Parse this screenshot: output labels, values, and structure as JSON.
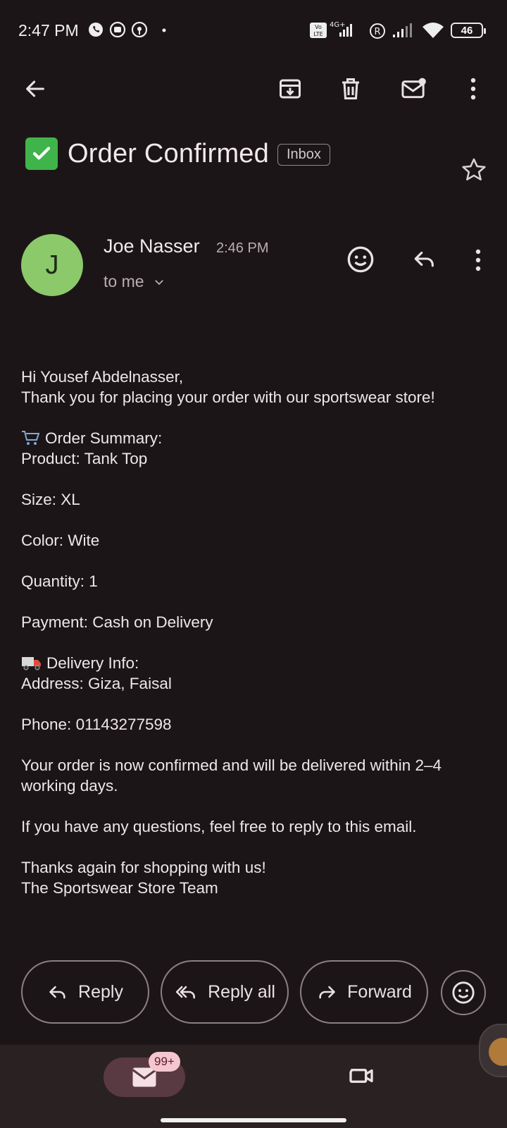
{
  "status_bar": {
    "time": "2:47 PM",
    "battery": "46"
  },
  "subject": {
    "title": "Order Confirmed",
    "label": "Inbox"
  },
  "sender": {
    "initial": "J",
    "name": "Joe Nasser",
    "time": "2:46 PM",
    "recipient": "to me"
  },
  "body": {
    "greeting": "Hi Yousef Abdelnasser,",
    "thanks": "Thank you for placing your order with our sportswear store!",
    "summary_heading": "Order Summary:",
    "product": "Product: Tank Top",
    "size": "Size: XL",
    "color": "Color: Wite",
    "quantity": "Quantity: 1",
    "payment": "Payment: Cash on Delivery",
    "delivery_heading": "Delivery Info:",
    "address": "Address: Giza, Faisal",
    "phone": "Phone: 01143277598",
    "confirmation": "Your order is now confirmed and will be delivered within 2–4 working days.",
    "questions": "If you have any questions, feel free to reply to this email.",
    "closing": "Thanks again for shopping with us!",
    "signature": "The Sportswear Store Team"
  },
  "actions": {
    "reply": "Reply",
    "reply_all": "Reply all",
    "forward": "Forward"
  },
  "bottom_nav": {
    "mail_badge": "99+"
  },
  "icons": {
    "toolbar": [
      "back-arrow-icon",
      "archive-icon",
      "delete-icon",
      "mark-unread-icon",
      "more-vert-icon"
    ],
    "sender_row": [
      "emoji-react-icon",
      "reply-icon",
      "more-vert-icon"
    ]
  },
  "colors": {
    "background": "#1c1517",
    "avatar": "#8bc96a",
    "accent_pill": "#5a3a42",
    "badge": "#f5c6cf"
  }
}
